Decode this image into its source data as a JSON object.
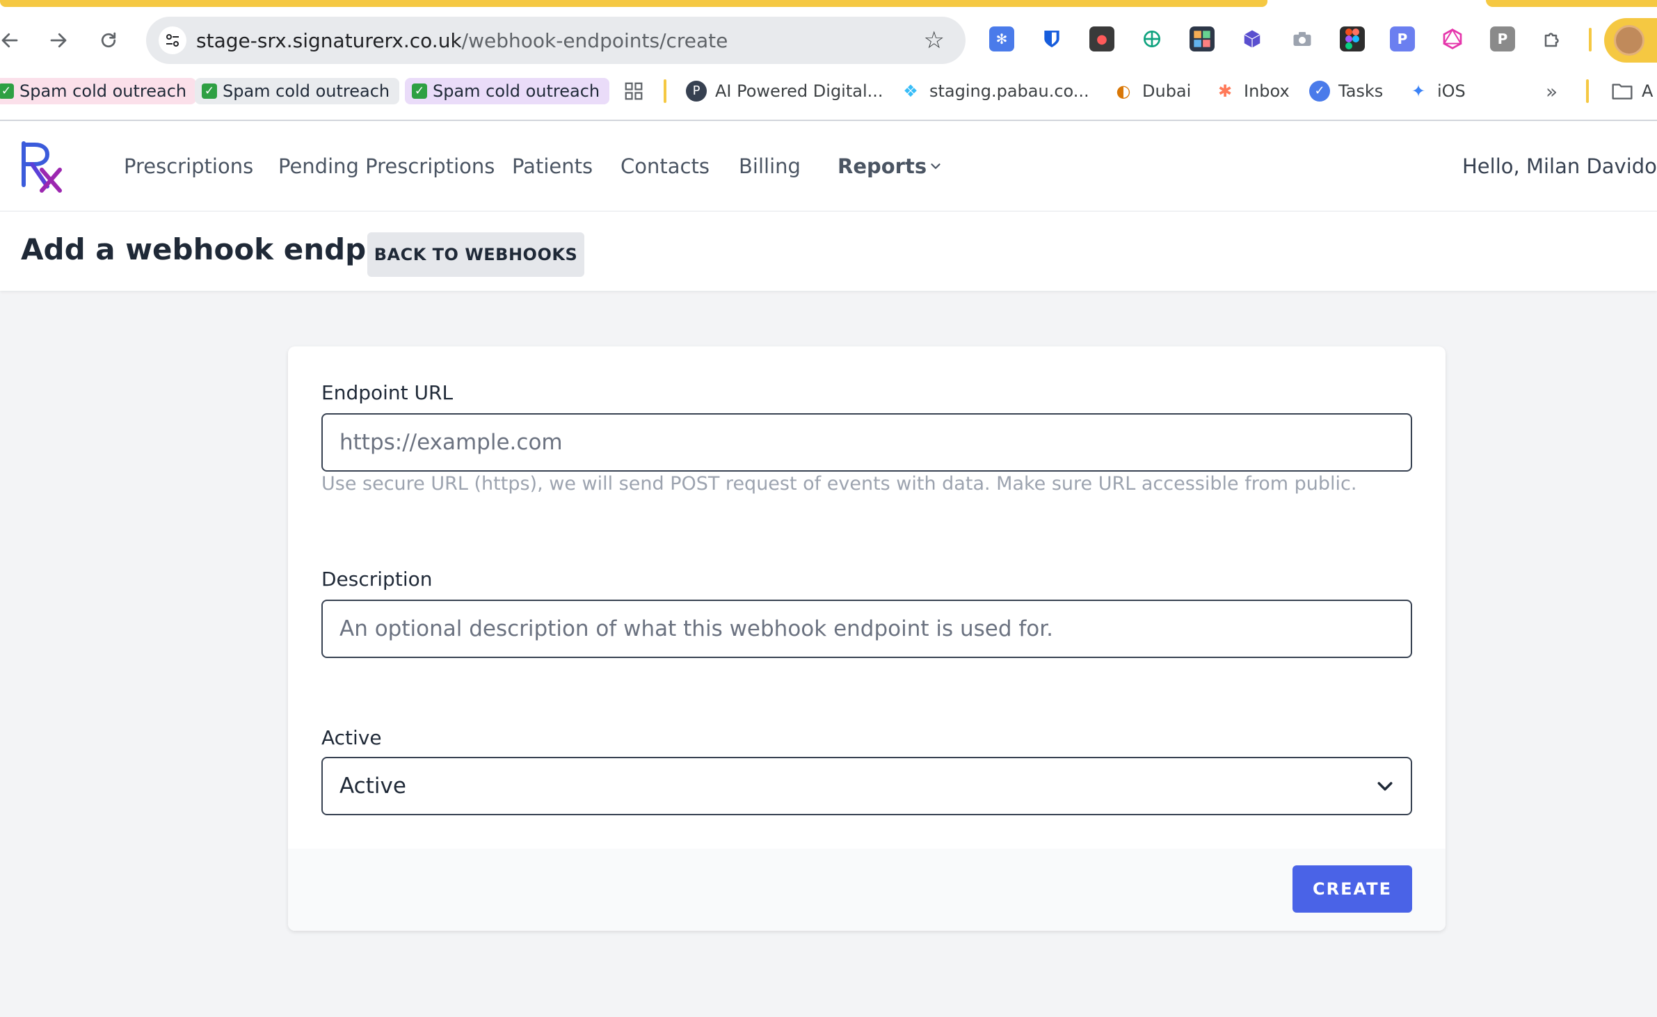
{
  "browser": {
    "url_host": "stage-srx.signaturerx.co.uk",
    "url_path": "/webhook-endpoints/create",
    "back_icon": "arrow-left-icon",
    "forward_icon": "arrow-right-icon",
    "reload_icon": "reload-icon",
    "extensions": [
      "asterisk-icon",
      "bitwarden-icon",
      "record-icon",
      "openai-icon",
      "grid-app-icon",
      "cube-icon",
      "camera-icon",
      "figma-icon",
      "p-icon",
      "graphql-icon",
      "p-gray-icon",
      "puzzle-icon"
    ],
    "ext_p_label": "P",
    "ext_p_gray_label": "P"
  },
  "bookmarks": {
    "items": [
      {
        "label": "Spam cold outreach"
      },
      {
        "label": "Spam cold outreach"
      },
      {
        "label": "Spam cold outreach"
      },
      {
        "label": "AI Powered Digital..."
      },
      {
        "label": "staging.pabau.co..."
      },
      {
        "label": "Dubai"
      },
      {
        "label": "Inbox"
      },
      {
        "label": "Tasks"
      },
      {
        "label": "iOS"
      },
      {
        "label": "A"
      }
    ]
  },
  "app": {
    "logo": "rx-logo",
    "nav": [
      "Prescriptions",
      "Pending Prescriptions",
      "Patients",
      "Contacts",
      "Billing",
      "Reports"
    ],
    "greeting": "Hello, Milan Davidovik"
  },
  "page": {
    "title": "Add a webhook endpoint",
    "back_button": "BACK TO WEBHOOKS"
  },
  "form": {
    "endpoint_label": "Endpoint URL",
    "endpoint_placeholder": "https://example.com",
    "endpoint_help": "Use secure URL (https), we will send POST request of events with data. Make sure URL accessible from public.",
    "description_label": "Description",
    "description_placeholder": "An optional description of what this webhook endpoint is used for.",
    "active_label": "Active",
    "active_value": "Active",
    "create_button": "CREATE"
  },
  "colors": {
    "primary": "#4a63e7",
    "chrome_accent": "#f5c842",
    "logo_blue": "#3b5bdb",
    "logo_purple": "#9c27b0"
  }
}
